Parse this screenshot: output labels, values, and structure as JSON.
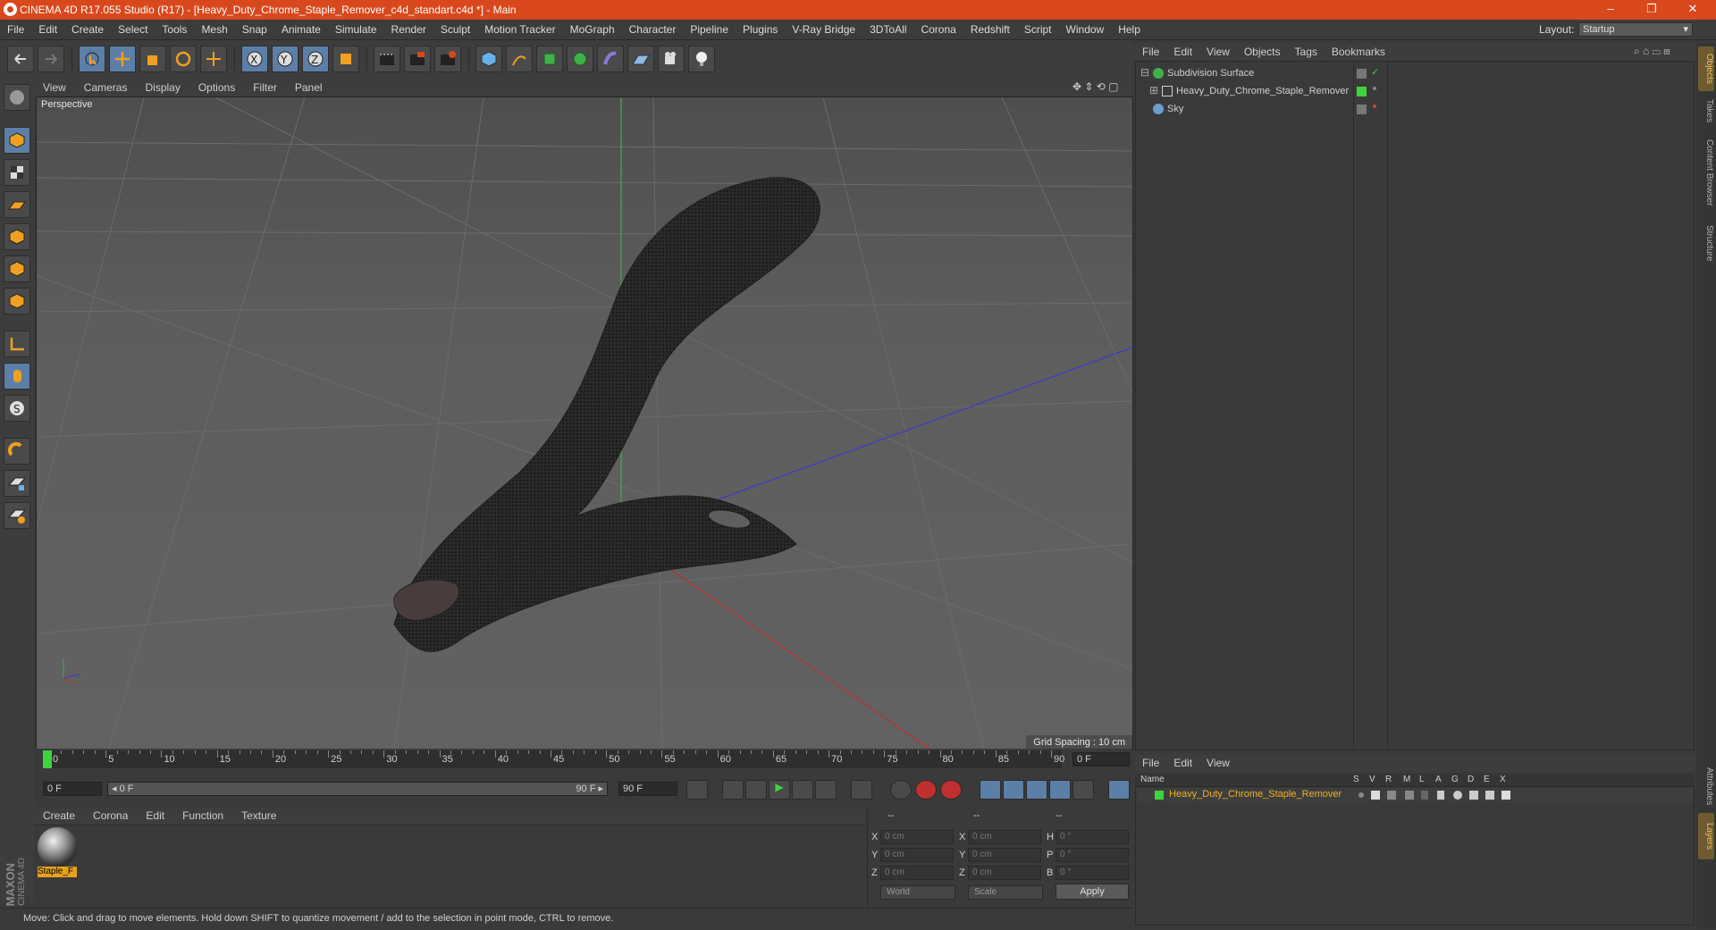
{
  "window": {
    "title": "CINEMA 4D R17.055 Studio (R17) - [Heavy_Duty_Chrome_Staple_Remover_c4d_standart.c4d *] - Main",
    "minimize": "–",
    "maximize": "❐",
    "close": "✕"
  },
  "menubar": {
    "items": [
      "File",
      "Edit",
      "Create",
      "Select",
      "Tools",
      "Mesh",
      "Snap",
      "Animate",
      "Simulate",
      "Render",
      "Sculpt",
      "Motion Tracker",
      "MoGraph",
      "Character",
      "Pipeline",
      "Plugins",
      "V-Ray Bridge",
      "3DToAll",
      "Corona",
      "Redshift",
      "Script",
      "Window",
      "Help"
    ],
    "layout_label": "Layout:",
    "layout_value": "Startup"
  },
  "viewport": {
    "menu": [
      "View",
      "Cameras",
      "Display",
      "Options",
      "Filter",
      "Panel"
    ],
    "label": "Perspective",
    "grid_spacing": "Grid Spacing : 10 cm"
  },
  "timeline": {
    "ticks": [
      "0",
      "5",
      "10",
      "15",
      "20",
      "25",
      "30",
      "35",
      "40",
      "45",
      "50",
      "55",
      "60",
      "65",
      "70",
      "75",
      "80",
      "85",
      "90"
    ],
    "current_frame": "0 F",
    "start_field": "0 F",
    "range_start": "◂ 0 F",
    "range_end": "90 F ▸",
    "end_field": "90 F"
  },
  "material_manager": {
    "menu": [
      "Create",
      "Corona",
      "Edit",
      "Function",
      "Texture"
    ],
    "materials": [
      {
        "name": "Staple_F"
      }
    ]
  },
  "coordinates": {
    "header": [
      "--",
      "--",
      "--"
    ],
    "rows": [
      {
        "a_label": "X",
        "a_val": "0 cm",
        "b_label": "X",
        "b_val": "0 cm",
        "c_label": "H",
        "c_val": "0 °"
      },
      {
        "a_label": "Y",
        "a_val": "0 cm",
        "b_label": "Y",
        "b_val": "0 cm",
        "c_label": "P",
        "c_val": "0 °"
      },
      {
        "a_label": "Z",
        "a_val": "0 cm",
        "b_label": "Z",
        "b_val": "0 cm",
        "c_label": "B",
        "c_val": "0 °"
      }
    ],
    "world": "World",
    "scale": "Scale",
    "apply": "Apply"
  },
  "status": {
    "text": "Move: Click and drag to move elements. Hold down SHIFT to quantize movement / add to the selection in point mode, CTRL to remove."
  },
  "object_manager": {
    "menu": [
      "File",
      "Edit",
      "View",
      "Objects",
      "Tags",
      "Bookmarks"
    ],
    "objects": [
      {
        "name": "Subdivision Surface",
        "color": "#3fb04a"
      },
      {
        "name": "Heavy_Duty_Chrome_Staple_Remover",
        "color": "#cfcfcf"
      },
      {
        "name": "Sky",
        "color": "#6a9fd0"
      }
    ]
  },
  "layer_manager": {
    "menu": [
      "File",
      "Edit",
      "View"
    ],
    "columns": [
      "Name",
      "S",
      "V",
      "R",
      "M",
      "L",
      "A",
      "G",
      "D",
      "E",
      "X"
    ],
    "layers": [
      {
        "name": "Heavy_Duty_Chrome_Staple_Remover",
        "color": "#3fd43f"
      }
    ]
  },
  "right_tabs": [
    "Objects",
    "Takes",
    "Content Browser",
    "Structure",
    "Attributes",
    "Layers"
  ],
  "brand": {
    "maxon": "MAXON",
    "cinema": "CINEMA 4D"
  },
  "colors": {
    "accent": "#d9481d",
    "highlight": "#e6a21b",
    "selection": "#5c7fa8"
  }
}
